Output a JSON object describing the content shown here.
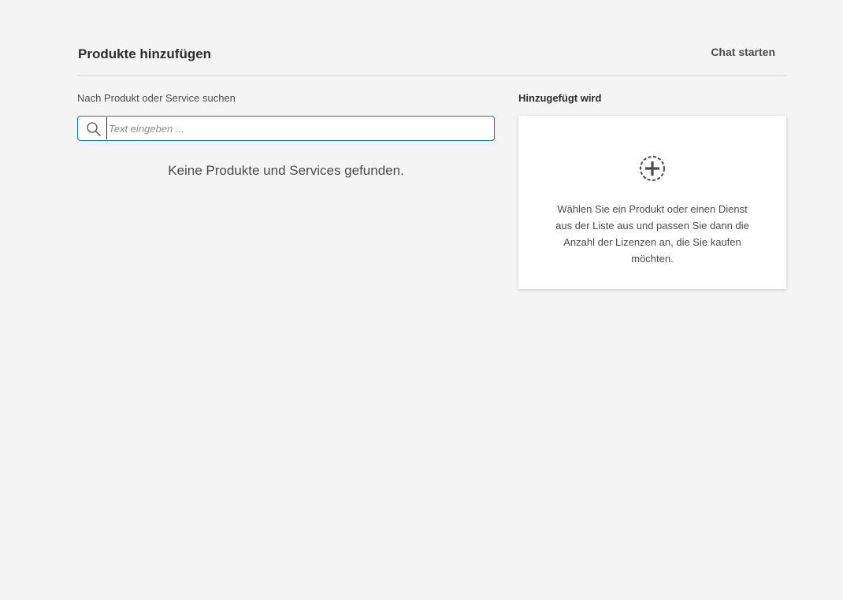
{
  "header": {
    "title": "Produkte hinzufügen",
    "chat_label": "Chat starten"
  },
  "search": {
    "label": "Nach Produkt oder Service suchen",
    "placeholder": "Text eingeben ...",
    "value": "",
    "icon": "search-icon",
    "empty_message": "Keine Produkte und Services gefunden."
  },
  "added": {
    "label": "Hinzugefügt wird",
    "icon": "add-circle-icon",
    "hint": "Wählen Sie ein Produkt oder einen Dienst aus der Liste aus und passen Sie dann die Anzahl der Lizenzen an, die Sie kaufen möchten."
  },
  "colors": {
    "background": "#f4f4f4",
    "accent": "#1473e6",
    "text": "#2c2c2c"
  }
}
